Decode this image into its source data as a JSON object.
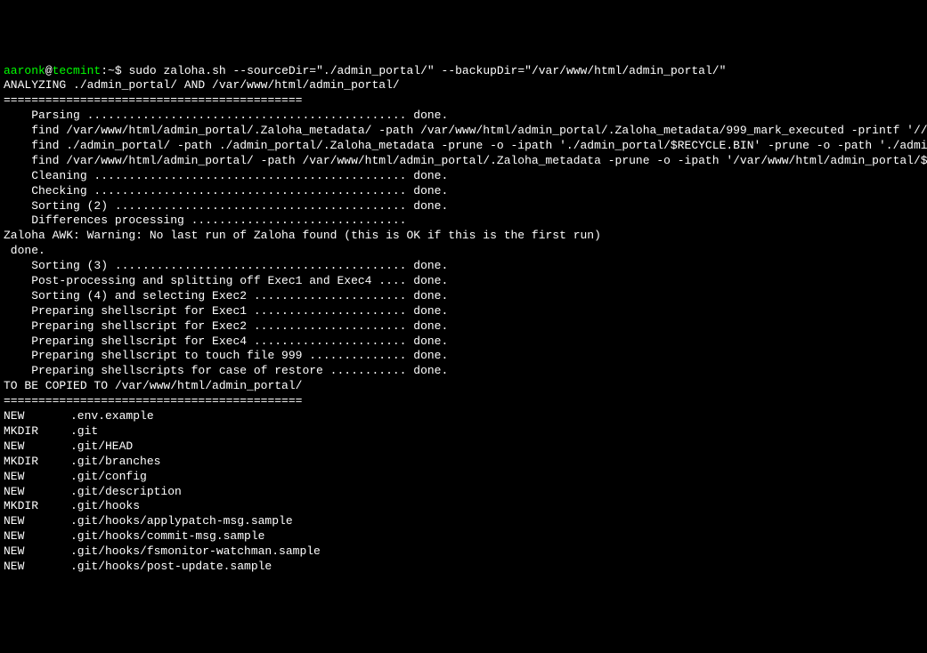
{
  "prompt": {
    "user": "aaronk",
    "at": "@",
    "host": "tecmint",
    "colon": ":",
    "path": "~",
    "symbol": "$ "
  },
  "command": "sudo zaloha.sh --sourceDir=\"./admin_portal/\" --backupDir=\"/var/www/html/admin_portal/\"",
  "output_lines": [
    "",
    "ANALYZING ./admin_portal/ AND /var/www/html/admin_portal/",
    "===========================================",
    "    Parsing .............................................. done.",
    "    find /var/www/html/admin_portal/.Zaloha_metadata/ -path /var/www/html/admin_portal/.Zaloha_metadata/999_mark_executed -printf '///\\tL\\t%y\\t%s\\t%Ts\\t%F\\t%D\\t%i\\t%n\\t%u\\t%g\\t%m\\t%P\\t///\\t%l\\t///\\n'",
    "    find ./admin_portal/ -path ./admin_portal/.Zaloha_metadata -prune -o -ipath './admin_portal/$RECYCLE.BIN' -prune -o -path './admin_portal/.Trash-[0-9]*' -prune -o -path ./admin_portal/lost+found -prune -o -printf '///\\tS\\t%y\\t%s\\t%Ts\\t%F\\t%D\\t%i\\t%n\\t%u\\t%g\\t%m\\t%P\\t///\\t%l\\t///\\n'",
    "    find /var/www/html/admin_portal/ -path /var/www/html/admin_portal/.Zaloha_metadata -prune -o -ipath '/var/www/html/admin_portal/$RECYCLE.BIN' -prune -o -path '/var/www/html/admin_portal/.Trash-[0-9]*' -prune -o -path /var/www/html/admin_portal/lost+found -prune -o -printf '///\\tB\\t%y\\t%s\\t%Ts\\t%F\\t%D\\t%i\\t%n\\t%u\\t%g\\t%m\\t%P\\t///\\t%l\\t///\\n'",
    "    Cleaning ............................................. done.",
    "    Checking ............................................. done.",
    "    Sorting (2) .......................................... done.",
    "    Differences processing ...............................",
    "Zaloha AWK: Warning: No last run of Zaloha found (this is OK if this is the first run)",
    " done.",
    "    Sorting (3) .......................................... done.",
    "    Post-processing and splitting off Exec1 and Exec4 .... done.",
    "    Sorting (4) and selecting Exec2 ...................... done.",
    "    Preparing shellscript for Exec1 ...................... done.",
    "    Preparing shellscript for Exec2 ...................... done.",
    "    Preparing shellscript for Exec4 ...................... done.",
    "    Preparing shellscript to touch file 999 .............. done.",
    "    Preparing shellscripts for case of restore ........... done.",
    "",
    "TO BE COPIED TO /var/www/html/admin_portal/",
    "==========================================="
  ],
  "file_list": [
    {
      "action": "NEW",
      "path": ".env.example"
    },
    {
      "action": "MKDIR",
      "path": ".git"
    },
    {
      "action": "NEW",
      "path": ".git/HEAD"
    },
    {
      "action": "MKDIR",
      "path": ".git/branches"
    },
    {
      "action": "NEW",
      "path": ".git/config"
    },
    {
      "action": "NEW",
      "path": ".git/description"
    },
    {
      "action": "MKDIR",
      "path": ".git/hooks"
    },
    {
      "action": "NEW",
      "path": ".git/hooks/applypatch-msg.sample"
    },
    {
      "action": "NEW",
      "path": ".git/hooks/commit-msg.sample"
    },
    {
      "action": "NEW",
      "path": ".git/hooks/fsmonitor-watchman.sample"
    },
    {
      "action": "NEW",
      "path": ".git/hooks/post-update.sample"
    }
  ]
}
